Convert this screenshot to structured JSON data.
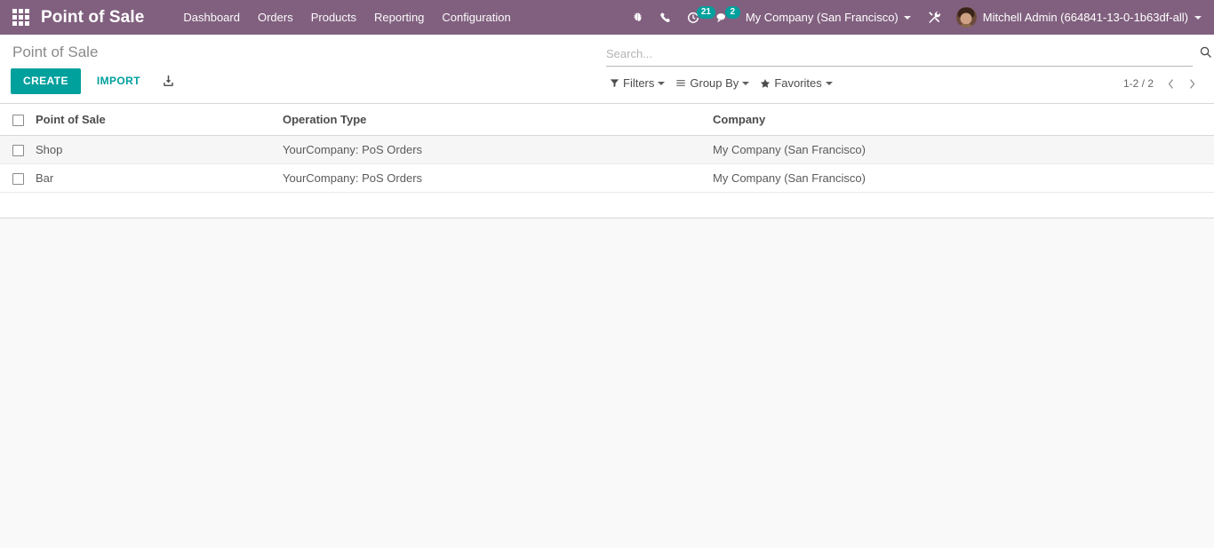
{
  "navbar": {
    "apps_icon": "apps-grid-icon",
    "brand": "Point of Sale",
    "menu": [
      {
        "label": "Dashboard"
      },
      {
        "label": "Orders"
      },
      {
        "label": "Products"
      },
      {
        "label": "Reporting"
      },
      {
        "label": "Configuration"
      }
    ],
    "icons": [
      {
        "name": "debug-bug-icon",
        "badge": null
      },
      {
        "name": "phone-icon",
        "badge": null
      },
      {
        "name": "activity-clock-icon",
        "badge": "21"
      },
      {
        "name": "messages-chat-icon",
        "badge": "2"
      }
    ],
    "company": "My Company (San Francisco)",
    "developer_tools_icon": "wrench-screwdriver-icon",
    "user": "Mitchell Admin (664841-13-0-1b63df-all)"
  },
  "control_panel": {
    "breadcrumb": "Point of Sale",
    "create_label": "CREATE",
    "import_label": "IMPORT",
    "export_icon": "download-export-icon",
    "search": {
      "value": "",
      "placeholder": "Search...",
      "icon": "search-magnifier-icon"
    },
    "filters_label": "Filters",
    "group_by_label": "Group By",
    "favorites_label": "Favorites",
    "pager": {
      "range": "1-2 / 2",
      "prev_icon": "chevron-left-icon",
      "next_icon": "chevron-right-icon"
    }
  },
  "list": {
    "columns": [
      "Point of Sale",
      "Operation Type",
      "Company"
    ],
    "rows": [
      {
        "name": "Shop",
        "operation_type": "YourCompany: PoS Orders",
        "company": "My Company (San Francisco)",
        "hovered": true
      },
      {
        "name": "Bar",
        "operation_type": "YourCompany: PoS Orders",
        "company": "My Company (San Francisco)",
        "hovered": false
      }
    ]
  },
  "colors": {
    "navbar_bg": "#81607f",
    "accent": "#00a09d",
    "page_bg": "#f9f9f9",
    "text": "#4c4c4c"
  }
}
